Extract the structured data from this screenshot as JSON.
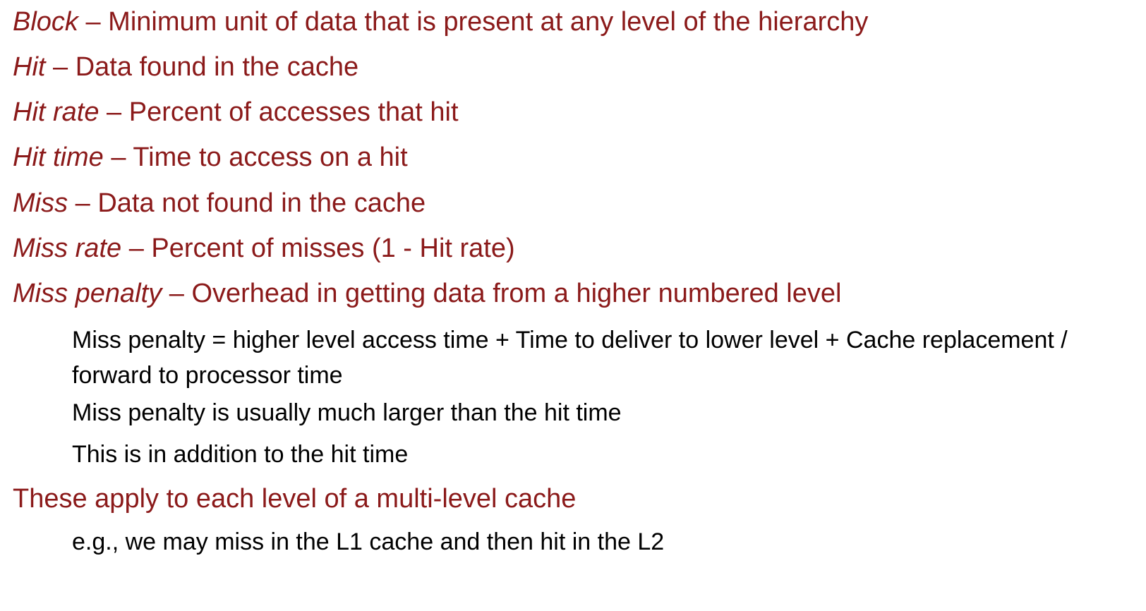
{
  "definitions": [
    {
      "term": "Block",
      "sep": " – ",
      "desc": "Minimum unit of data that is present at any level of the hierarchy"
    },
    {
      "term": "Hit",
      "sep": " – ",
      "desc": "Data found in the cache"
    },
    {
      "term": "Hit rate",
      "sep": " – ",
      "desc": "Percent of accesses that hit"
    },
    {
      "term": "Hit time",
      "sep": " – ",
      "desc": "Time to access on a hit"
    },
    {
      "term": "Miss",
      "sep": " – ",
      "desc": "Data not found in the cache"
    },
    {
      "term": "Miss rate",
      "sep": " – ",
      "desc": "Percent of misses (1 - Hit rate)"
    },
    {
      "term": "Miss penalty",
      "sep": " – ",
      "desc": "Overhead in getting data from a higher numbered level"
    }
  ],
  "miss_penalty_notes": [
    "Miss penalty = higher level access time + Time to deliver to lower level + Cache replacement / forward to processor time",
    "Miss penalty is usually much larger than the hit time",
    "This is in addition to the hit time"
  ],
  "multilevel": {
    "heading": "These apply to each level of a multi-level cache",
    "example": "e.g., we may miss in the L1 cache and then hit in the L2"
  },
  "colors": {
    "accent": "#8b1a1a",
    "body_text": "#000000"
  }
}
